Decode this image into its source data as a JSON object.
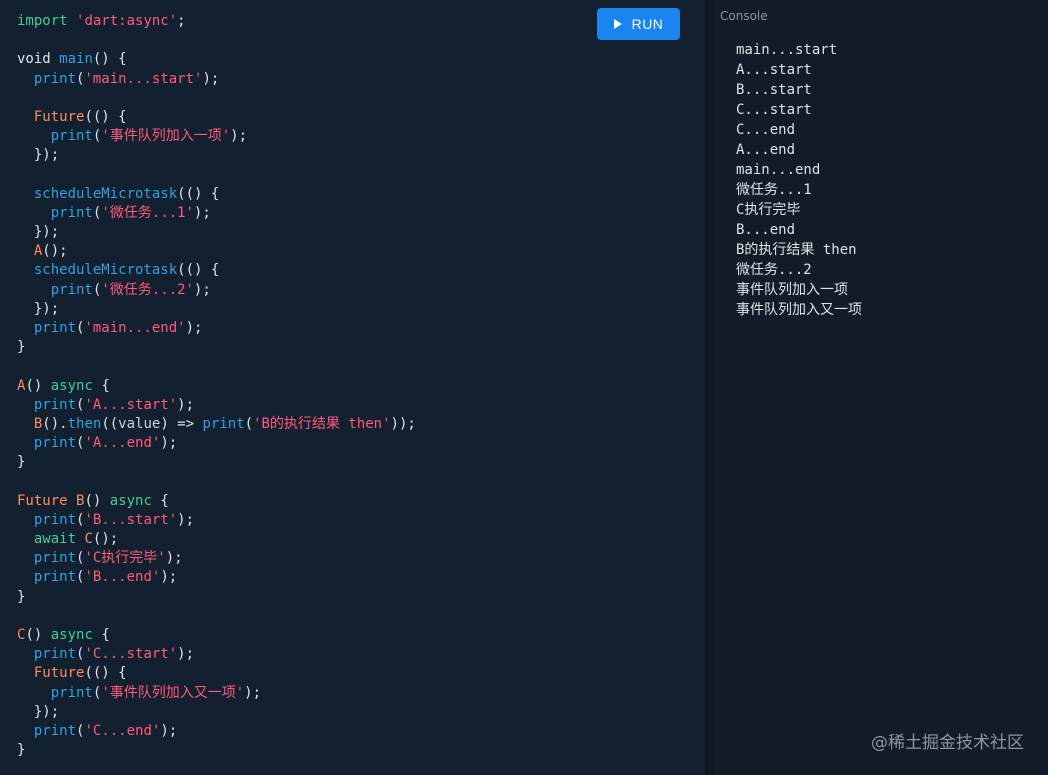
{
  "toolbar": {
    "run_label": "RUN"
  },
  "console": {
    "title": "Console",
    "lines": [
      "main...start",
      "A...start",
      "B...start",
      "C...start",
      "C...end",
      "A...end",
      "main...end",
      "微任务...1",
      "C执行完毕",
      "B...end",
      "B的执行结果 then",
      "微任务...2",
      "事件队列加入一项",
      "事件队列加入又一项"
    ]
  },
  "editor": {
    "lines": [
      [
        [
          "kw",
          "import"
        ],
        [
          "plain",
          " "
        ],
        [
          "str",
          "'dart:async'"
        ],
        [
          "plain",
          ";"
        ]
      ],
      [],
      [
        [
          "plain",
          "void "
        ],
        [
          "call",
          "main"
        ],
        [
          "plain",
          "() {"
        ]
      ],
      [
        [
          "plain",
          "  "
        ],
        [
          "call",
          "print"
        ],
        [
          "plain",
          "("
        ],
        [
          "str",
          "'main...start'"
        ],
        [
          "plain",
          ");"
        ]
      ],
      [],
      [
        [
          "plain",
          "  "
        ],
        [
          "fn",
          "Future"
        ],
        [
          "plain",
          "(() {"
        ]
      ],
      [
        [
          "plain",
          "    "
        ],
        [
          "call",
          "print"
        ],
        [
          "plain",
          "("
        ],
        [
          "str",
          "'事件队列加入一项'"
        ],
        [
          "plain",
          ");"
        ]
      ],
      [
        [
          "plain",
          "  });"
        ]
      ],
      [],
      [
        [
          "plain",
          "  "
        ],
        [
          "call",
          "scheduleMicrotask"
        ],
        [
          "plain",
          "(() {"
        ]
      ],
      [
        [
          "plain",
          "    "
        ],
        [
          "call",
          "print"
        ],
        [
          "plain",
          "("
        ],
        [
          "str",
          "'微任务...1'"
        ],
        [
          "plain",
          ");"
        ]
      ],
      [
        [
          "plain",
          "  });"
        ]
      ],
      [
        [
          "plain",
          "  "
        ],
        [
          "fn",
          "A"
        ],
        [
          "plain",
          "();"
        ]
      ],
      [
        [
          "plain",
          "  "
        ],
        [
          "call",
          "scheduleMicrotask"
        ],
        [
          "plain",
          "(() {"
        ]
      ],
      [
        [
          "plain",
          "    "
        ],
        [
          "call",
          "print"
        ],
        [
          "plain",
          "("
        ],
        [
          "str",
          "'微任务...2'"
        ],
        [
          "plain",
          ");"
        ]
      ],
      [
        [
          "plain",
          "  });"
        ]
      ],
      [
        [
          "plain",
          "  "
        ],
        [
          "call",
          "print"
        ],
        [
          "plain",
          "("
        ],
        [
          "str",
          "'main...end'"
        ],
        [
          "plain",
          ");"
        ]
      ],
      [
        [
          "plain",
          "}"
        ]
      ],
      [],
      [
        [
          "fn",
          "A"
        ],
        [
          "plain",
          "() "
        ],
        [
          "kw",
          "async"
        ],
        [
          "plain",
          " {"
        ]
      ],
      [
        [
          "plain",
          "  "
        ],
        [
          "call",
          "print"
        ],
        [
          "plain",
          "("
        ],
        [
          "str",
          "'A...start'"
        ],
        [
          "plain",
          ");"
        ]
      ],
      [
        [
          "plain",
          "  "
        ],
        [
          "fn",
          "B"
        ],
        [
          "plain",
          "()."
        ],
        [
          "call",
          "then"
        ],
        [
          "plain",
          "(("
        ],
        [
          "var",
          "value"
        ],
        [
          "plain",
          ") => "
        ],
        [
          "call",
          "print"
        ],
        [
          "plain",
          "("
        ],
        [
          "str",
          "'B的执行结果 then'"
        ],
        [
          "plain",
          "));"
        ]
      ],
      [
        [
          "plain",
          "  "
        ],
        [
          "call",
          "print"
        ],
        [
          "plain",
          "("
        ],
        [
          "str",
          "'A...end'"
        ],
        [
          "plain",
          ");"
        ]
      ],
      [
        [
          "plain",
          "}"
        ]
      ],
      [],
      [
        [
          "fn",
          "Future"
        ],
        [
          "plain",
          " "
        ],
        [
          "fn",
          "B"
        ],
        [
          "plain",
          "() "
        ],
        [
          "kw",
          "async"
        ],
        [
          "plain",
          " {"
        ]
      ],
      [
        [
          "plain",
          "  "
        ],
        [
          "call",
          "print"
        ],
        [
          "plain",
          "("
        ],
        [
          "str",
          "'B...start'"
        ],
        [
          "plain",
          ");"
        ]
      ],
      [
        [
          "plain",
          "  "
        ],
        [
          "kw",
          "await"
        ],
        [
          "plain",
          " "
        ],
        [
          "fn",
          "C"
        ],
        [
          "plain",
          "();"
        ]
      ],
      [
        [
          "plain",
          "  "
        ],
        [
          "call",
          "print"
        ],
        [
          "plain",
          "("
        ],
        [
          "str",
          "'C执行完毕'"
        ],
        [
          "plain",
          ");"
        ]
      ],
      [
        [
          "plain",
          "  "
        ],
        [
          "call",
          "print"
        ],
        [
          "plain",
          "("
        ],
        [
          "str",
          "'B...end'"
        ],
        [
          "plain",
          ");"
        ]
      ],
      [
        [
          "plain",
          "}"
        ]
      ],
      [],
      [
        [
          "fn",
          "C"
        ],
        [
          "plain",
          "() "
        ],
        [
          "kw",
          "async"
        ],
        [
          "plain",
          " {"
        ]
      ],
      [
        [
          "plain",
          "  "
        ],
        [
          "call",
          "print"
        ],
        [
          "plain",
          "("
        ],
        [
          "str",
          "'C...start'"
        ],
        [
          "plain",
          ");"
        ]
      ],
      [
        [
          "plain",
          "  "
        ],
        [
          "fn",
          "Future"
        ],
        [
          "plain",
          "(() {"
        ]
      ],
      [
        [
          "plain",
          "    "
        ],
        [
          "call",
          "print"
        ],
        [
          "plain",
          "("
        ],
        [
          "str",
          "'事件队列加入又一项'"
        ],
        [
          "plain",
          ");"
        ]
      ],
      [
        [
          "plain",
          "  });"
        ]
      ],
      [
        [
          "plain",
          "  "
        ],
        [
          "call",
          "print"
        ],
        [
          "plain",
          "("
        ],
        [
          "str",
          "'C...end'"
        ],
        [
          "plain",
          ");"
        ]
      ],
      [
        [
          "plain",
          "}"
        ]
      ]
    ]
  },
  "watermark": "@稀土掘金技术社区",
  "colors": {
    "keyword": "#3fcf97",
    "string": "#ff5a7a",
    "identifier": "#ff8a5c",
    "call": "#33a0e0",
    "run_button": "#1a84f0"
  }
}
